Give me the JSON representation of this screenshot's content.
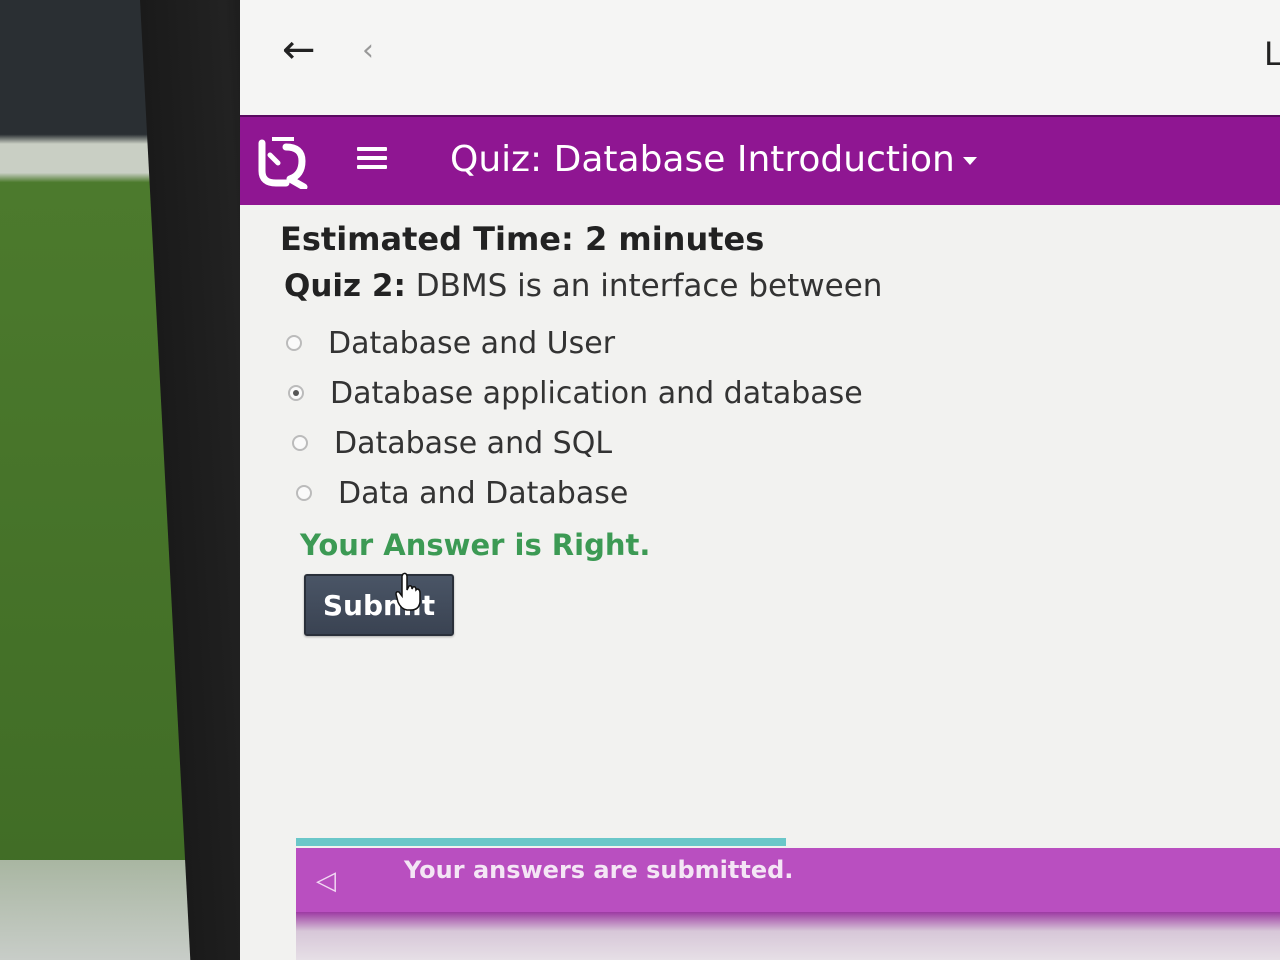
{
  "browser": {
    "back_arrow": "←",
    "back_chevron": "‹",
    "edge_letter": "L"
  },
  "app": {
    "title": "Quiz: Database Introduction",
    "colors": {
      "appbar": "#8f1692",
      "success": "#3c9a54",
      "footer": "#b94fc0",
      "submit": "#3a4352"
    }
  },
  "quiz": {
    "estimated_time": "Estimated Time: 2 minutes",
    "question_label": "Quiz 2:",
    "question_text": "DBMS is an interface between",
    "options": [
      {
        "label": "Database and User",
        "selected": false
      },
      {
        "label": "Database application and database",
        "selected": true
      },
      {
        "label": "Database and SQL",
        "selected": false
      },
      {
        "label": "Data and Database",
        "selected": false
      }
    ],
    "result": "Your Answer is Right.",
    "submit_label": "Submit"
  },
  "footer": {
    "prev_icon": "◁",
    "message": "Your answers are submitted."
  }
}
